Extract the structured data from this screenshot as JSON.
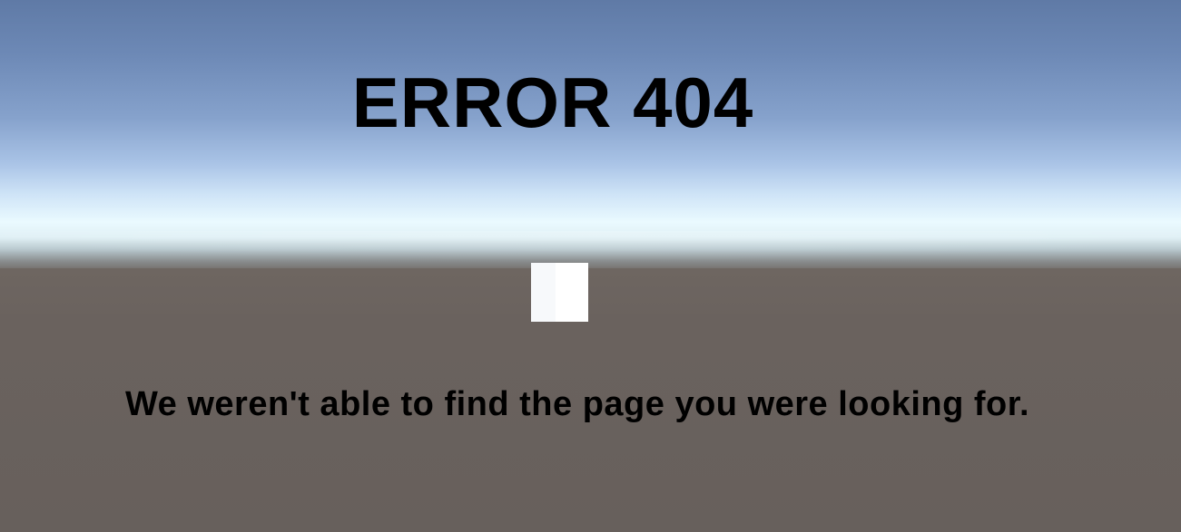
{
  "scene": {
    "sky_top_color": "#5f7aa6",
    "horizon_color": "#eafaff",
    "ground_color": "#67605c",
    "cube_color": "#ffffff"
  },
  "error": {
    "title": "ERROR 404",
    "message": "We weren't able to find the page you were looking for."
  }
}
